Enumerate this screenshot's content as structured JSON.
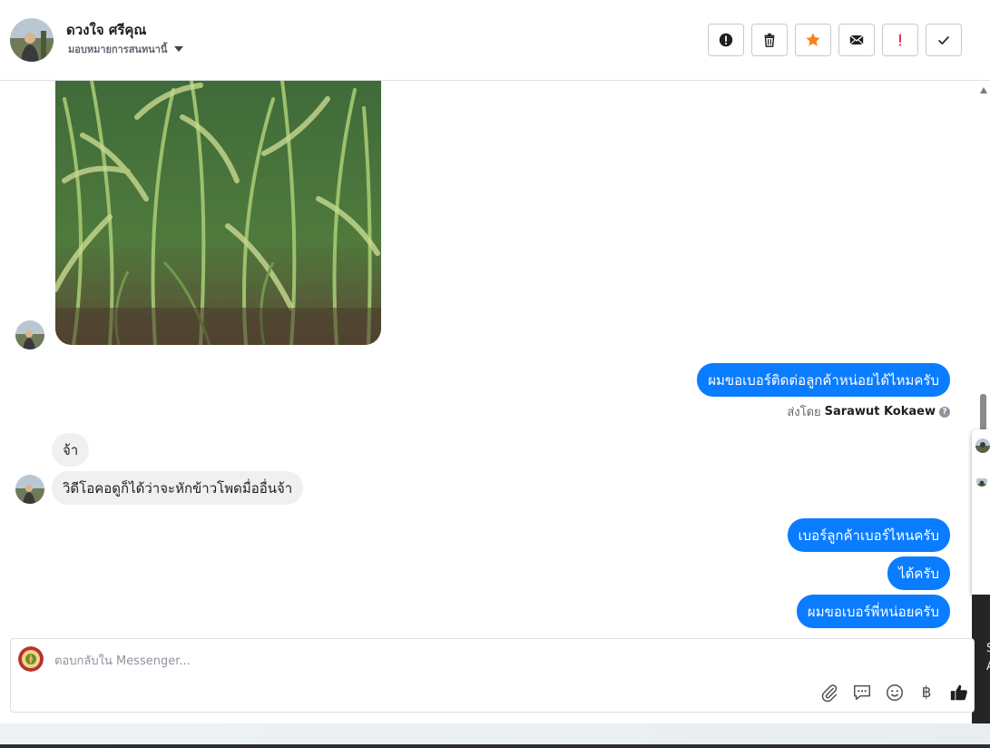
{
  "header": {
    "contact_name": "ดวงใจ ศรีคุณ",
    "assign_label": "มอบหมายการสนทนานี้",
    "buttons": [
      {
        "name": "alert-button",
        "icon": "exclamation-circle-icon"
      },
      {
        "name": "delete-button",
        "icon": "trash-icon"
      },
      {
        "name": "star-button",
        "icon": "star-icon",
        "color": "#f5821f"
      },
      {
        "name": "mark-unread-button",
        "icon": "envelope-icon"
      },
      {
        "name": "spam-button",
        "icon": "exclamation-icon",
        "color": "#e41e3f"
      },
      {
        "name": "done-button",
        "icon": "check-icon"
      }
    ]
  },
  "thread": {
    "messages": [
      {
        "direction": "in",
        "type": "image",
        "description_icon": "corn-field-photo"
      },
      {
        "direction": "out",
        "text": "ผมขอเบอร์ติดต่อลูกค้าหน่อยได้ไหมครับ"
      },
      {
        "sent_by_prefix": "ส่งโดย",
        "sent_by_name": "Sarawut Kokaew"
      },
      {
        "direction": "in",
        "text": "จ้า"
      },
      {
        "direction": "in",
        "text": "วิดีโอคอดูก็ได้ว่าจะหักข้าวโพดมื่ออื่นจ้า"
      },
      {
        "direction": "out",
        "text": "เบอร์ลูกค้าเบอร์ไหนครับ"
      },
      {
        "direction": "out",
        "text": "ได้ครับ"
      },
      {
        "direction": "out",
        "text": "ผมขอเบอร์พี่หน่อยครับ"
      }
    ]
  },
  "composer": {
    "placeholder": "ตอบกลับใน Messenger...",
    "tools": [
      "paperclip-icon",
      "saved-reply-icon",
      "emoji-icon",
      "baht-icon",
      "thumbs-up-icon"
    ],
    "baht_symbol": "฿"
  },
  "side_panel": {
    "dark_letters": [
      "S",
      "A"
    ]
  },
  "colors": {
    "outgoing_bubble": "#0a7cff",
    "incoming_bubble": "#f0f0f0",
    "star": "#f5821f",
    "spam": "#e41e3f"
  }
}
